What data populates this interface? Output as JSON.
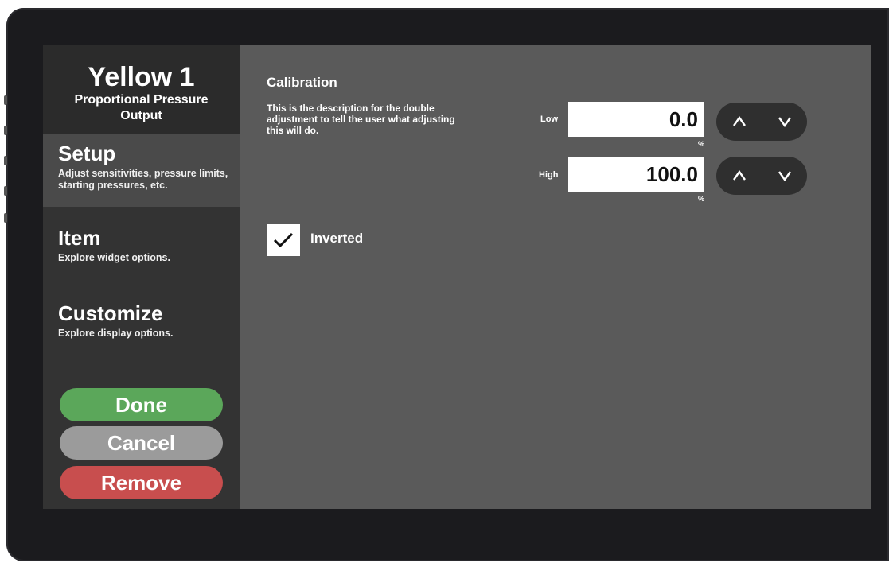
{
  "header": {
    "title": "Yellow 1",
    "subtitle": "Proportional Pressure Output"
  },
  "nav": [
    {
      "title": "Setup",
      "desc": "Adjust sensitivities, pressure limits, starting pressures, etc.",
      "active": true
    },
    {
      "title": "Item",
      "desc": "Explore widget options.",
      "active": false
    },
    {
      "title": "Customize",
      "desc": "Explore display options.",
      "active": false
    }
  ],
  "actions": {
    "done": "Done",
    "cancel": "Cancel",
    "remove": "Remove"
  },
  "colors": {
    "done": "#5ba75a",
    "cancel": "#9b9b9b",
    "remove": "#c84e4e"
  },
  "calibration": {
    "title": "Calibration",
    "description": "This is the description for the double adjustment to tell the user what adjusting this will do.",
    "low": {
      "label": "Low",
      "value": "0.0",
      "unit": "%"
    },
    "high": {
      "label": "High",
      "value": "100.0",
      "unit": "%"
    }
  },
  "inverted": {
    "label": "Inverted",
    "checked": true
  }
}
